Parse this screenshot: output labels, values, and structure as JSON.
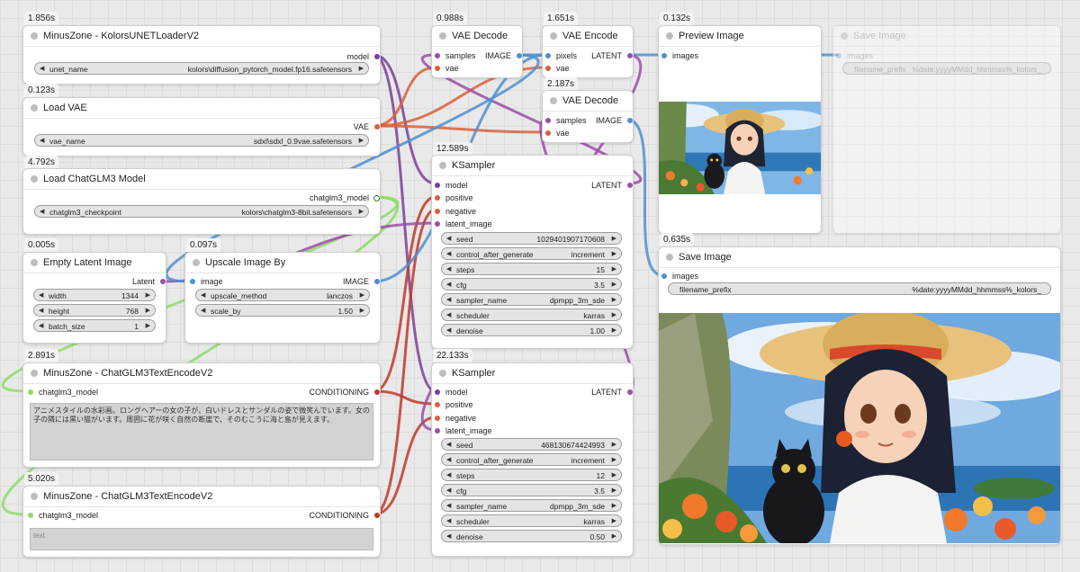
{
  "colors": {
    "model": "#7b3f99",
    "vae": "#d9603b",
    "latent": "#9b4ea8",
    "image": "#4d8fd1",
    "conditioning": "#c0392b",
    "chatglm": "#8fdc6a"
  },
  "nodes": {
    "unet_loader": {
      "time": "1.856s",
      "title": "MinusZone - KolorsUNETLoaderV2",
      "output": "model",
      "widget_label": "unet_name",
      "widget_value": "kolors\\diffusion_pytorch_model.fp16.safetensors"
    },
    "load_vae": {
      "time": "0.123s",
      "title": "Load VAE",
      "output": "VAE",
      "widget_label": "vae_name",
      "widget_value": "sdxl\\sdxl_0.9vae.safetensors"
    },
    "load_chatglm": {
      "time": "4.792s",
      "title": "Load ChatGLM3 Model",
      "output": "chatglm3_model",
      "widget_label": "chatglm3_checkpoint",
      "widget_value": "kolors\\chatglm3-8bit.safetensors"
    },
    "empty_latent": {
      "time": "0.005s",
      "title": "Empty Latent Image",
      "output": "Latent",
      "widgets": [
        {
          "label": "width",
          "value": "1344"
        },
        {
          "label": "height",
          "value": "768"
        },
        {
          "label": "batch_size",
          "value": "1"
        }
      ]
    },
    "upscale": {
      "time": "0.097s",
      "title": "Upscale Image By",
      "input": "image",
      "output": "IMAGE",
      "widgets": [
        {
          "label": "upscale_method",
          "value": "lanczos"
        },
        {
          "label": "scale_by",
          "value": "1.50"
        }
      ]
    },
    "text_encode_1": {
      "time": "2.891s",
      "title": "MinusZone - ChatGLM3TextEncodeV2",
      "input": "chatglm3_model",
      "output": "CONDITIONING",
      "text": "アニメスタイルの水彩画。ロングヘアーの女の子が、白いドレスとサンダルの姿で微笑んでいます。女の子の隣には黒い猫がいます。周囲に花が咲く自然の断崖で、そのむこうに海と島が見えます。"
    },
    "text_encode_2": {
      "time": "5.020s",
      "title": "MinusZone - ChatGLM3TextEncodeV2",
      "input": "chatglm3_model",
      "output": "CONDITIONING",
      "placeholder": "text"
    },
    "vae_decode_1": {
      "time": "0.988s",
      "title": "VAE Decode",
      "inputs": [
        "samples",
        "vae"
      ],
      "output": "IMAGE"
    },
    "vae_encode": {
      "time": "1.651s",
      "title": "VAE Encode",
      "inputs": [
        "pixels",
        "vae"
      ],
      "output": "LATENT"
    },
    "vae_decode_2": {
      "time": "2.187s",
      "title": "VAE Decode",
      "inputs": [
        "samples",
        "vae"
      ],
      "output": "IMAGE"
    },
    "ksampler_1": {
      "time": "12.589s",
      "title": "KSampler",
      "inputs": [
        "model",
        "positive",
        "negative",
        "latent_image"
      ],
      "output": "LATENT",
      "widgets": [
        {
          "label": "seed",
          "value": "1029401907170608"
        },
        {
          "label": "control_after_generate",
          "value": "increment"
        },
        {
          "label": "steps",
          "value": "15"
        },
        {
          "label": "cfg",
          "value": "3.5"
        },
        {
          "label": "sampler_name",
          "value": "dpmpp_3m_sde"
        },
        {
          "label": "scheduler",
          "value": "karras"
        },
        {
          "label": "denoise",
          "value": "1.00"
        }
      ]
    },
    "ksampler_2": {
      "time": "22.133s",
      "title": "KSampler",
      "inputs": [
        "model",
        "positive",
        "negative",
        "latent_image"
      ],
      "output": "LATENT",
      "widgets": [
        {
          "label": "seed",
          "value": "468130674424993"
        },
        {
          "label": "control_after_generate",
          "value": "increment"
        },
        {
          "label": "steps",
          "value": "12"
        },
        {
          "label": "cfg",
          "value": "3.5"
        },
        {
          "label": "sampler_name",
          "value": "dpmpp_3m_sde"
        },
        {
          "label": "scheduler",
          "value": "karras"
        },
        {
          "label": "denoise",
          "value": "0.50"
        }
      ]
    },
    "preview": {
      "time": "0.132s",
      "title": "Preview Image",
      "input": "images"
    },
    "save_faded": {
      "title": "Save Image",
      "input": "images",
      "widget_label": "filename_prefix",
      "widget_value": "%date:yyyyMMdd_hhmmss%_kolors_"
    },
    "save": {
      "time": "0.635s",
      "title": "Save Image",
      "input": "images",
      "widget_label": "filename_prefix",
      "widget_value": "%date:yyyyMMdd_hhmmss%_kolors_"
    }
  }
}
